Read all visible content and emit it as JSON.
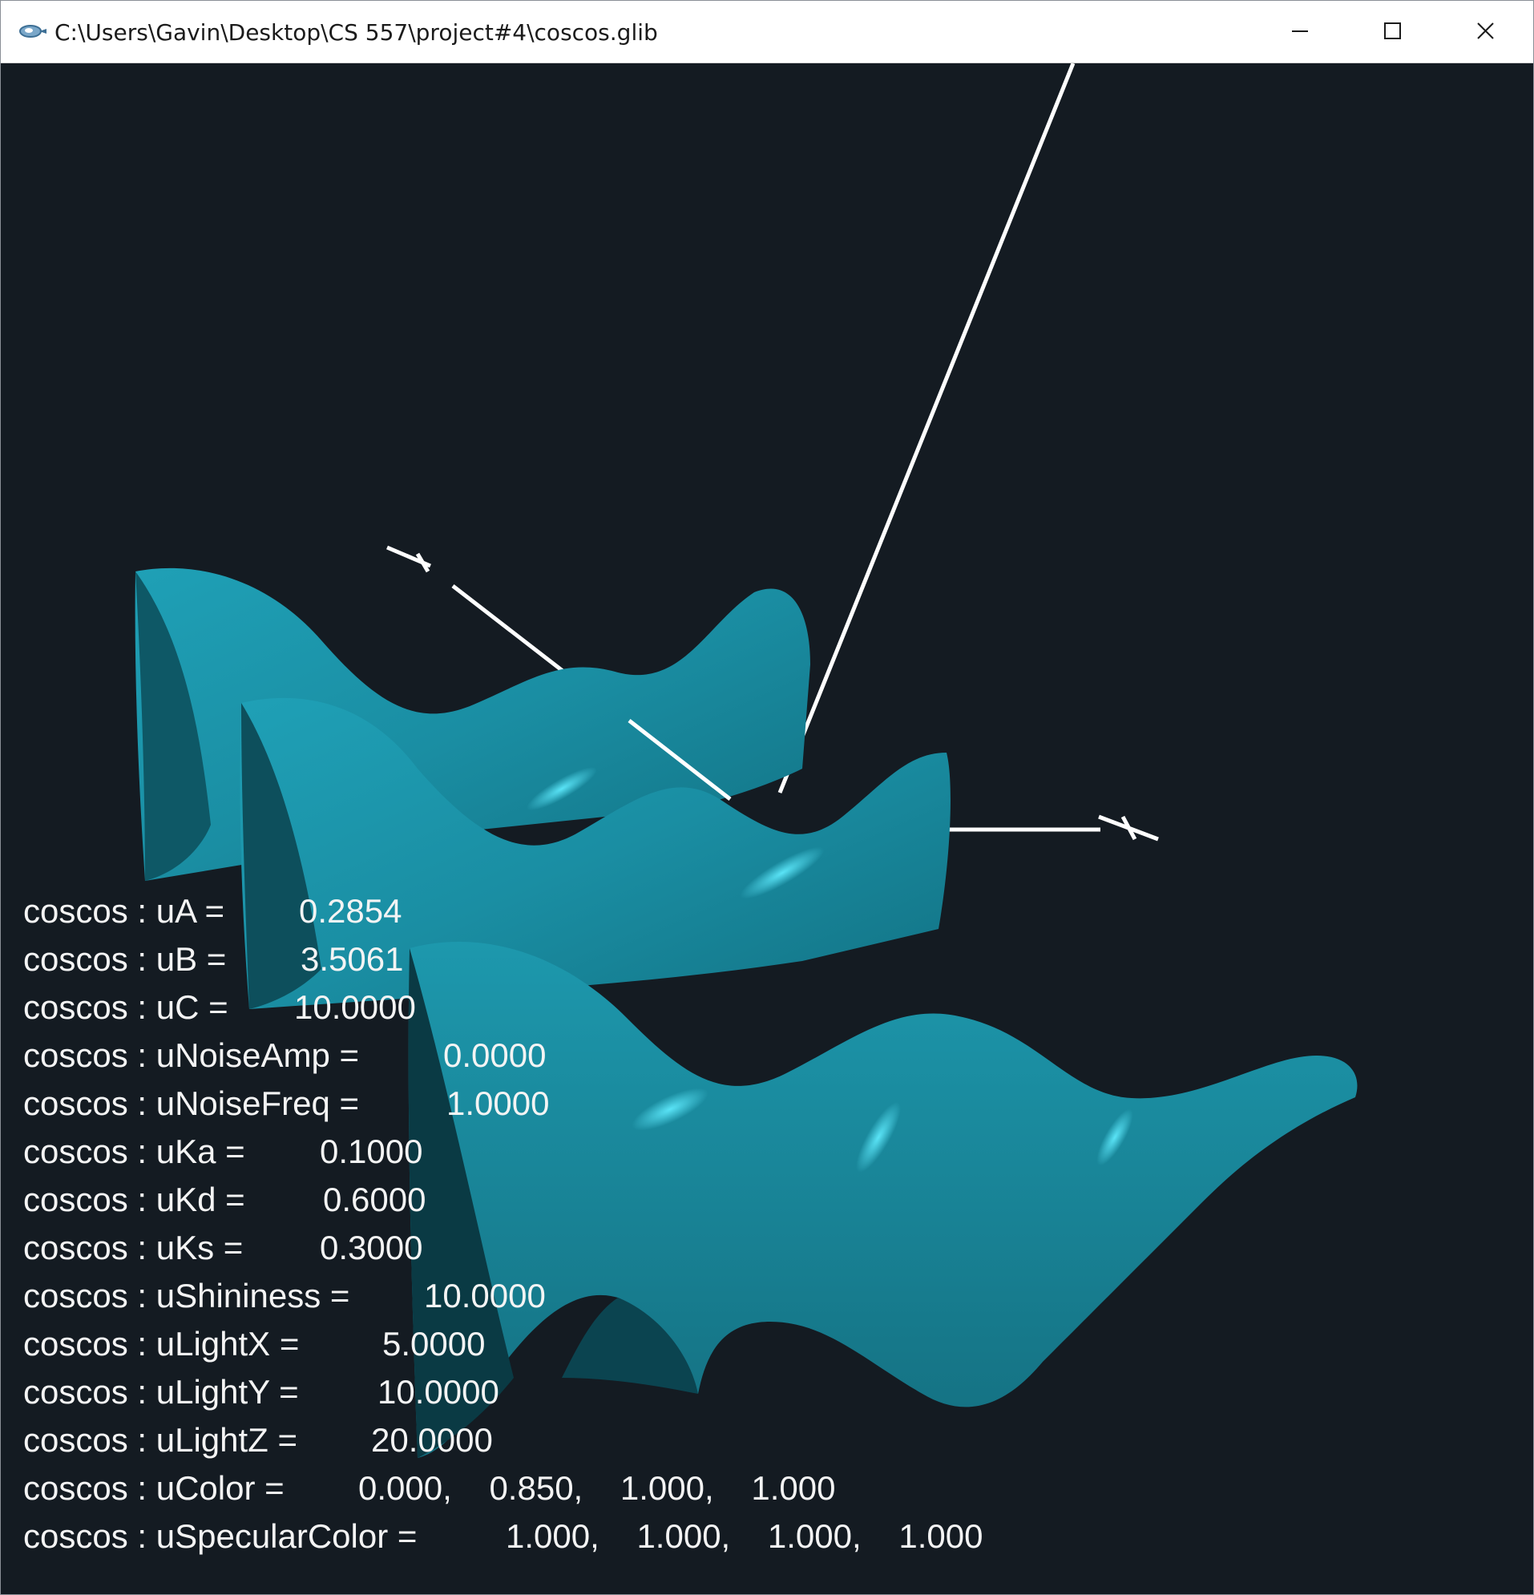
{
  "window": {
    "title": "C:\\Users\\Gavin\\Desktop\\CS 557\\project#4\\coscos.glib"
  },
  "icons": {
    "app": "glman-app-icon",
    "minimize": "minimize-icon",
    "maximize": "maximize-icon",
    "close": "close-icon"
  },
  "colors": {
    "background": "#141b22",
    "surface": "#1b8fa3",
    "surface_highlight": "#48d7ee",
    "axes": "#ffffff",
    "text": "#f4f4f4"
  },
  "params": [
    {
      "label": "coscos : uA =",
      "value": "0.2854"
    },
    {
      "label": "coscos : uB =",
      "value": "3.5061"
    },
    {
      "label": "coscos : uC =",
      "value": "10.0000"
    },
    {
      "label": "coscos : uNoiseAmp =",
      "value": "0.0000"
    },
    {
      "label": "coscos : uNoiseFreq =",
      "value": "1.0000"
    },
    {
      "label": "coscos : uKa =",
      "value": "0.1000"
    },
    {
      "label": "coscos : uKd =",
      "value": "0.6000"
    },
    {
      "label": "coscos : uKs =",
      "value": "0.3000"
    },
    {
      "label": "coscos : uShininess =",
      "value": "10.0000"
    },
    {
      "label": "coscos : uLightX =",
      "value": "5.0000"
    },
    {
      "label": "coscos : uLightY =",
      "value": "10.0000"
    },
    {
      "label": "coscos : uLightZ =",
      "value": "20.0000"
    },
    {
      "label": "coscos : uColor =",
      "value": "0.000,    0.850,    1.000,    1.000"
    },
    {
      "label": "coscos : uSpecularColor =",
      "value": "1.000,    1.000,    1.000,    1.000"
    }
  ]
}
